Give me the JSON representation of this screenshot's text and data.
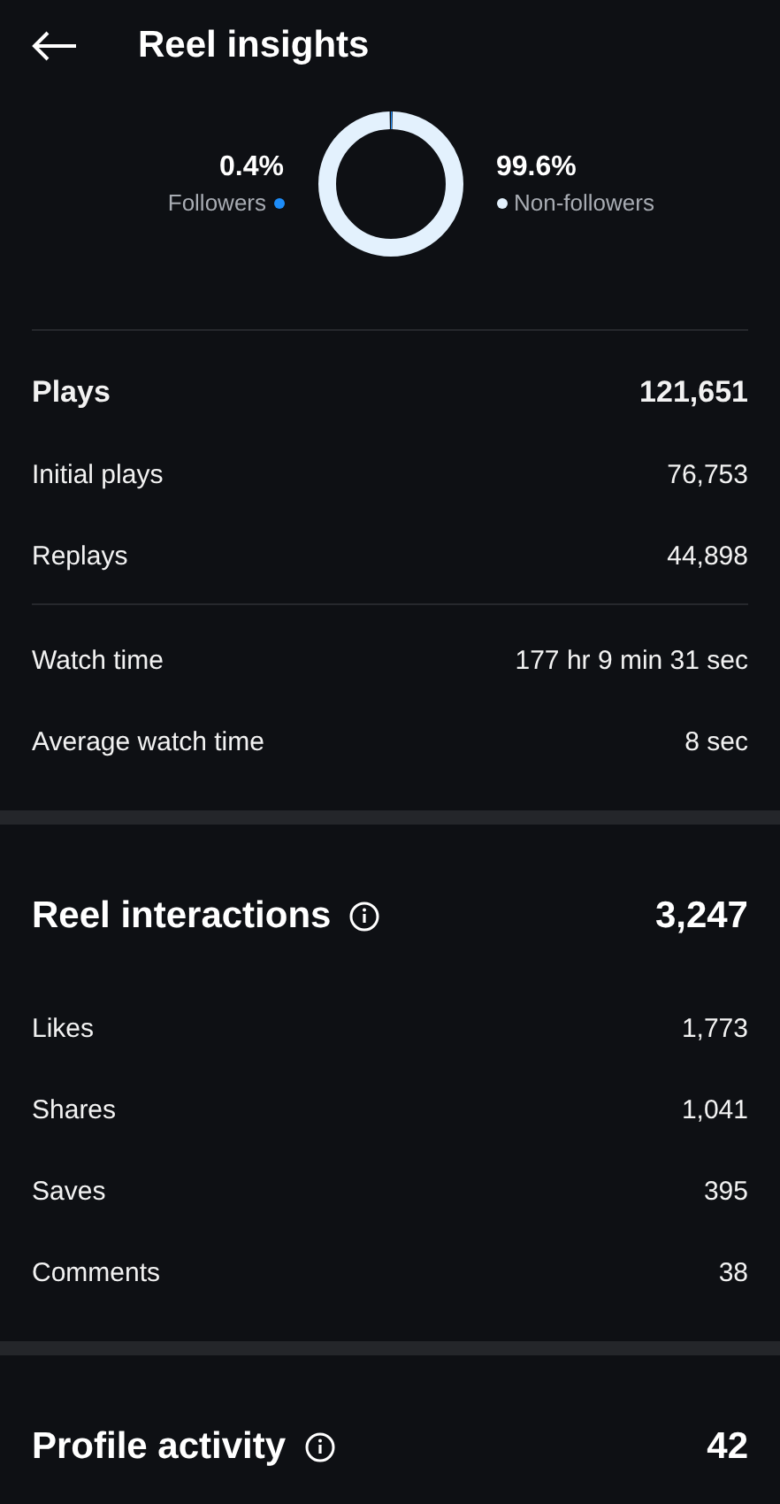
{
  "header": {
    "title": "Reel insights"
  },
  "audience": {
    "legend": [
      {
        "value": "0.4%",
        "label": "Followers",
        "color": "#1d8cf8"
      },
      {
        "value": "99.6%",
        "label": "Non-followers",
        "color": "#e3f1fd"
      }
    ]
  },
  "sections": [
    {
      "kind": "plain",
      "groups": [
        [
          {
            "kind": "total",
            "label": "Plays",
            "value": "121,651"
          },
          {
            "kind": "metric",
            "label": "Initial plays",
            "value": "76,753"
          },
          {
            "kind": "metric",
            "label": "Replays",
            "value": "44,898"
          }
        ],
        [
          {
            "kind": "metric",
            "label": "Watch time",
            "value": "177 hr 9 min 31 sec"
          },
          {
            "kind": "metric",
            "label": "Average watch time",
            "value": "8 sec"
          }
        ]
      ]
    },
    {
      "kind": "headed",
      "title": "Reel interactions",
      "total": "3,247",
      "groups": [
        [
          {
            "kind": "metric",
            "label": "Likes",
            "value": "1,773"
          },
          {
            "kind": "metric",
            "label": "Shares",
            "value": "1,041"
          },
          {
            "kind": "metric",
            "label": "Saves",
            "value": "395"
          },
          {
            "kind": "metric",
            "label": "Comments",
            "value": "38"
          }
        ]
      ]
    },
    {
      "kind": "headed",
      "title": "Profile activity",
      "total": "42"
    }
  ]
}
